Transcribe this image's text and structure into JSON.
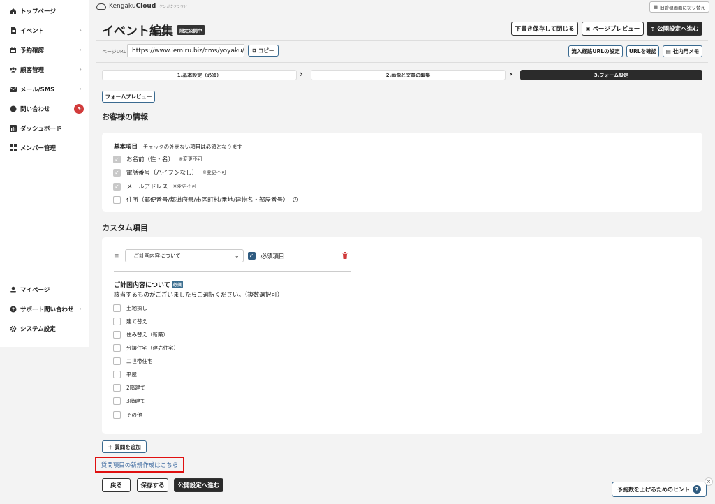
{
  "sidebar": {
    "items": [
      {
        "label": "トップページ",
        "icon": "home-icon",
        "chevron": false
      },
      {
        "label": "イベント",
        "icon": "document-icon",
        "chevron": true
      },
      {
        "label": "予約確認",
        "icon": "calendar-icon",
        "chevron": true
      },
      {
        "label": "顧客管理",
        "icon": "users-icon",
        "chevron": true
      },
      {
        "label": "メール/SMS",
        "icon": "mail-icon",
        "chevron": true
      },
      {
        "label": "問い合わせ",
        "icon": "chat-icon",
        "chevron": true,
        "badge": "3"
      },
      {
        "label": "ダッシュボード",
        "icon": "chart-icon",
        "chevron": false
      },
      {
        "label": "メンバー管理",
        "icon": "grid-icon",
        "chevron": false
      }
    ],
    "bottom_items": [
      {
        "label": "マイページ",
        "icon": "user-icon",
        "chevron": false
      },
      {
        "label": "サポート問い合わせ",
        "icon": "help-icon",
        "chevron": true
      },
      {
        "label": "システム設定",
        "icon": "gear-icon",
        "chevron": false
      }
    ]
  },
  "header": {
    "logo_text": "Kengaku",
    "logo_bold": "Cloud",
    "logo_small": "ケンガククラウド",
    "switch_label": "旧管理画面に切り替え",
    "title": "イベント編集",
    "title_badge": "限定公開中",
    "save_close": "下書き保存して閉じる",
    "preview": "ページプレビュー",
    "publish": "公開設定へ進む"
  },
  "url_row": {
    "label": "ページURL",
    "url": "https://www.iemiru.biz/cms/yoyaku/",
    "copy": "コピー",
    "inflow": "流入経路URLの設定",
    "confirm": "URLを確認",
    "memo": "社内用メモ"
  },
  "steps": [
    {
      "label": "1.基本設定（必須）",
      "active": false
    },
    {
      "label": "2.画像と文章の編集",
      "active": false
    },
    {
      "label": "3.フォーム設定",
      "active": true
    }
  ],
  "form_preview": "フォームプレビュー",
  "customer_section": {
    "title": "お客様の情報",
    "basic_label": "基本項目",
    "basic_note": "チェックの外せない項目は必須となります",
    "items": [
      {
        "label": "お名前（性・名）",
        "note": "※変更不可",
        "checked": true
      },
      {
        "label": "電話番号（ハイフンなし）",
        "note": "※変更不可",
        "checked": true
      },
      {
        "label": "メールアドレス",
        "note": "※変更不可",
        "checked": true
      },
      {
        "label": "住所（郵便番号/都道府県/市区町村/番地/建物名・部屋番号）",
        "note": "",
        "checked": false
      }
    ]
  },
  "custom_section": {
    "title": "カスタム項目",
    "select_value": "ご計画内容について",
    "required_label": "必須項目",
    "question_title": "ご計画内容について",
    "question_badge": "必須",
    "question_desc": "該当するものがございましたらご選択ください。（複数選択可）",
    "options": [
      "土地探し",
      "建て替え",
      "住み替え（新築）",
      "分譲住宅（建売住宅）",
      "二世帯住宅",
      "平屋",
      "2階建て",
      "3階建て",
      "その他"
    ]
  },
  "add_question": "＋ 質問を追加",
  "new_question_link": "質問項目の新規作成はこちら",
  "footer_buttons": {
    "back": "戻る",
    "save": "保存する",
    "publish": "公開設定へ進む"
  },
  "hint": {
    "label": "予約数を上げるためのヒント",
    "q": "?",
    "close": "×"
  }
}
